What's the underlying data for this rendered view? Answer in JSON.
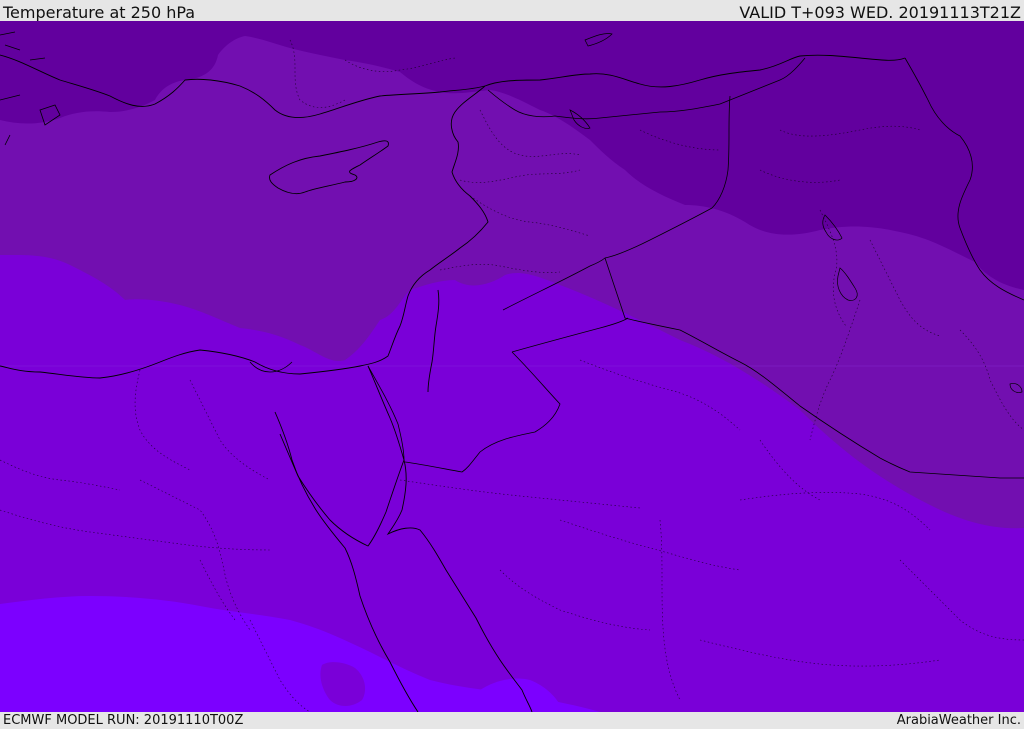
{
  "header": {
    "title": "Temperature at 250 hPa",
    "valid_time": "VALID T+093 WED. 20191113T21Z"
  },
  "footer": {
    "model_run": "ECMWF MODEL RUN: 20191110T00Z",
    "credit": "ArabiaWeather Inc."
  },
  "map": {
    "colors": {
      "band_coldest": "#62009e",
      "band_cold": "#720fb0",
      "band_mid": "#7a00d8",
      "band_warm": "#7c00ff",
      "coastline": "#000000",
      "border": "#000000"
    }
  }
}
